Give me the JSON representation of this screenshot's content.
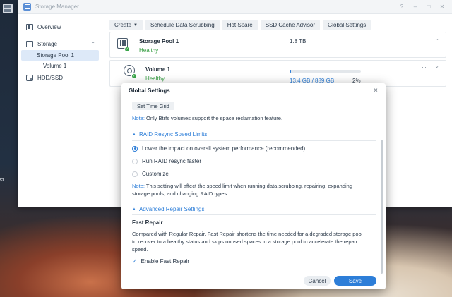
{
  "desktop": {
    "edge_label": "er"
  },
  "window": {
    "title": "Storage Manager",
    "controls": {
      "help": "?",
      "minimize": "–",
      "maximize": "□",
      "close": "✕"
    }
  },
  "sidebar": {
    "overview": "Overview",
    "storage": "Storage",
    "storage_pool": "Storage Pool 1",
    "volume": "Volume 1",
    "hdd": "HDD/SSD"
  },
  "toolbar": {
    "create": "Create",
    "scrubbing": "Schedule Data Scrubbing",
    "hot_spare": "Hot Spare",
    "ssd_cache": "SSD Cache Advisor",
    "global_settings": "Global Settings"
  },
  "pool": {
    "name": "Storage Pool 1",
    "status": "Healthy",
    "size": "1.8 TB",
    "dots": "···",
    "chevron": "⌄"
  },
  "volume": {
    "name": "Volume 1",
    "status": "Healthy",
    "used": "13.4 GB / 889 GB",
    "percent": "2%",
    "usage_fraction": 0.02,
    "dots": "···",
    "chevron": "⌄"
  },
  "dialog": {
    "title": "Global Settings",
    "close": "×",
    "set_time_grid": "Set Time Grid",
    "note1_prefix": "Note:",
    "note1_text": " Only Btrfs volumes support the space reclamation feature.",
    "raid_section": "RAID Resync Speed Limits",
    "radio_lower": "Lower the impact on overall system performance (recommended)",
    "radio_faster": "Run RAID resync faster",
    "radio_custom": "Customize",
    "note2_prefix": "Note:",
    "note2_text": " This setting will affect the speed limit when running data scrubbing, repairing, expanding storage pools, and changing RAID types.",
    "repair_section": "Advanced Repair Settings",
    "fast_repair_title": "Fast Repair",
    "fast_repair_desc": "Compared with Regular Repair, Fast Repair shortens the time needed for a degraded storage pool to recover to a healthy status and skips unused spaces in a storage pool to accelerate the repair speed.",
    "enable_fast_repair": "Enable Fast Repair",
    "cancel": "Cancel",
    "save": "Save"
  },
  "colors": {
    "accent": "#2d7ed8",
    "healthy": "#2f9a3c"
  }
}
